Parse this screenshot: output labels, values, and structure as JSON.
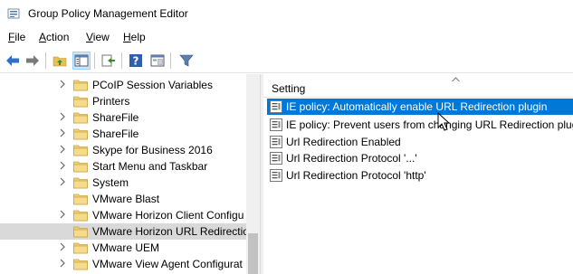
{
  "window": {
    "title": "Group Policy Management Editor"
  },
  "menu": [
    {
      "label": "File",
      "accel": "F",
      "rest": "ile"
    },
    {
      "label": "Action",
      "accel": "A",
      "rest": "ction"
    },
    {
      "label": "View",
      "accel": "V",
      "rest": "iew"
    },
    {
      "label": "Help",
      "accel": "H",
      "rest": "elp"
    }
  ],
  "toolbar": {
    "icons": [
      "back-arrow-icon",
      "forward-arrow-icon",
      "up-folder-icon",
      "show-hide-tree-icon",
      "export-list-icon",
      "help-icon",
      "properties-icon",
      "filter-icon"
    ]
  },
  "tree": {
    "items": [
      {
        "label": "PCoIP Session Variables",
        "expandable": true,
        "selected": false
      },
      {
        "label": "Printers",
        "expandable": false,
        "selected": false
      },
      {
        "label": "ShareFile",
        "expandable": true,
        "selected": false
      },
      {
        "label": "ShareFile",
        "expandable": true,
        "selected": false
      },
      {
        "label": "Skype for Business 2016",
        "expandable": true,
        "selected": false
      },
      {
        "label": "Start Menu and Taskbar",
        "expandable": true,
        "selected": false
      },
      {
        "label": "System",
        "expandable": true,
        "selected": false
      },
      {
        "label": "VMware Blast",
        "expandable": false,
        "selected": false
      },
      {
        "label": "VMware Horizon Client Configu",
        "expandable": true,
        "selected": false
      },
      {
        "label": "VMware Horizon URL Redirectio",
        "expandable": false,
        "selected": true
      },
      {
        "label": "VMware UEM",
        "expandable": true,
        "selected": false
      },
      {
        "label": "VMware View Agent Configurat",
        "expandable": true,
        "selected": false
      }
    ]
  },
  "settings": {
    "column_header": "Setting",
    "rows": [
      {
        "label": "IE policy: Automatically enable URL Redirection plugin",
        "selected": true
      },
      {
        "label": "IE policy: Prevent users from changing URL Redirection plugi",
        "selected": false
      },
      {
        "label": "Url Redirection Enabled",
        "selected": false
      },
      {
        "label": "Url Redirection Protocol '...'",
        "selected": false
      },
      {
        "label": "Url Redirection Protocol 'http'",
        "selected": false
      }
    ]
  },
  "colors": {
    "selection": "#0078d7",
    "tree_selection": "#d9d9d9",
    "folder": "#e8c05a"
  }
}
